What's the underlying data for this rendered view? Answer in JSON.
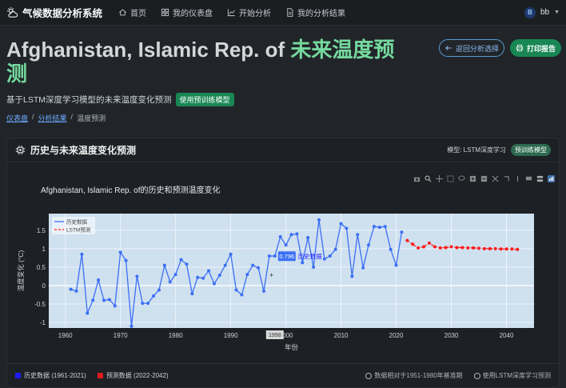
{
  "app": {
    "brand": "气候数据分析系统"
  },
  "nav": {
    "home": "首页",
    "dashboard": "我的仪表盘",
    "start_analysis": "开始分析",
    "my_results": "我的分析结果",
    "user_initial": "B",
    "user_name": "bb"
  },
  "header": {
    "title_country": "Afghanistan, Islamic Rep. of",
    "title_highlight": "未来温度预测",
    "subtitle": "基于LSTM深度学习模型的未来温度变化预测",
    "subtitle_badge": "使用预训练模型",
    "back_button": "返回分析选择",
    "print_button": "打印报告"
  },
  "breadcrumb": {
    "item1": "仪表盘",
    "item2": "分析结果",
    "item3": "温度预测"
  },
  "card": {
    "title": "历史与未来温度变化预测",
    "model_label": "模型: LSTM深度学习",
    "model_badge": "预训练模型"
  },
  "footer": {
    "legend_hist": "历史数据 (1961-2021)",
    "legend_pred": "预测数据 (2022-2042)",
    "note_baseline": "数据相对于1951-1980年基准期",
    "note_model": "使用LSTM深度学习预测"
  },
  "colors": {
    "historical": "#3b6ff5",
    "predicted": "#ff1a1a",
    "plot_bg": "#cfe0ef",
    "accent_green": "#198754"
  },
  "chart_data": {
    "type": "line",
    "title": "Afghanistan, Islamic Rep. of的历史和预测温度变化",
    "xlabel": "年份",
    "ylabel": "温度变化 (°C)",
    "xlim": [
      1957,
      2045
    ],
    "ylim": [
      -1.15,
      1.95
    ],
    "xticks": [
      1960,
      1970,
      1980,
      1990,
      2000,
      2010,
      2020,
      2030,
      2040
    ],
    "yticks": [
      -1,
      -0.5,
      0,
      0.5,
      1,
      1.5
    ],
    "legend_position": "top-left",
    "hover": {
      "year": "1998",
      "value": "0.796",
      "series": "历史数据"
    },
    "series": [
      {
        "name": "历史数据",
        "x": [
          1961,
          1962,
          1963,
          1964,
          1965,
          1966,
          1967,
          1968,
          1969,
          1970,
          1971,
          1972,
          1973,
          1974,
          1975,
          1976,
          1977,
          1978,
          1979,
          1980,
          1981,
          1982,
          1983,
          1984,
          1985,
          1986,
          1987,
          1988,
          1989,
          1990,
          1991,
          1992,
          1993,
          1994,
          1995,
          1996,
          1997,
          1998,
          1999,
          2000,
          2001,
          2002,
          2003,
          2004,
          2005,
          2006,
          2007,
          2008,
          2009,
          2010,
          2011,
          2012,
          2013,
          2014,
          2015,
          2016,
          2017,
          2018,
          2019,
          2020,
          2021
        ],
        "values": [
          -0.1,
          -0.15,
          0.85,
          -0.75,
          -0.4,
          0.15,
          -0.4,
          -0.38,
          -0.55,
          0.9,
          0.68,
          -1.1,
          0.25,
          -0.48,
          -0.48,
          -0.28,
          -0.12,
          0.55,
          0.1,
          0.3,
          0.7,
          0.58,
          -0.22,
          0.22,
          0.2,
          0.4,
          0.05,
          0.28,
          0.55,
          0.85,
          -0.12,
          -0.25,
          0.3,
          0.55,
          0.48,
          -0.15,
          0.8,
          0.8,
          1.32,
          1.1,
          1.38,
          1.4,
          0.62,
          1.3,
          0.5,
          1.78,
          0.72,
          0.8,
          0.98,
          1.68,
          1.55,
          0.25,
          1.38,
          0.48,
          1.1,
          1.6,
          1.58,
          1.6,
          0.98,
          0.55,
          1.45
        ]
      },
      {
        "name": "LSTM预测",
        "x": [
          2022,
          2023,
          2024,
          2025,
          2026,
          2027,
          2028,
          2029,
          2030,
          2031,
          2032,
          2033,
          2034,
          2035,
          2036,
          2037,
          2038,
          2039,
          2040,
          2041,
          2042
        ],
        "values": [
          1.22,
          1.12,
          1.02,
          1.05,
          1.15,
          1.05,
          1.02,
          1.03,
          1.05,
          1.03,
          1.03,
          1.02,
          1.02,
          1.01,
          1.0,
          1.0,
          1.0,
          0.99,
          0.99,
          0.99,
          0.98
        ]
      }
    ]
  }
}
